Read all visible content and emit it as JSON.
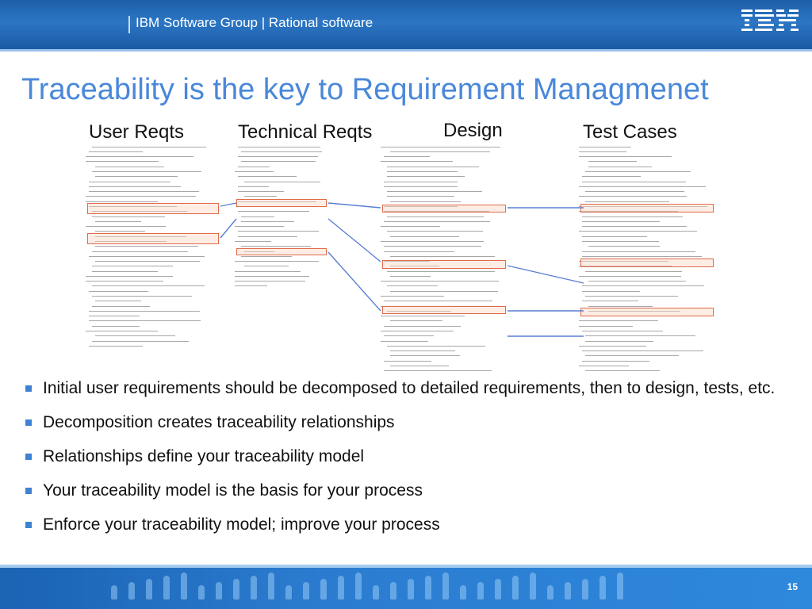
{
  "header": {
    "group_title": "IBM Software Group | Rational software",
    "logo_text": "IBM"
  },
  "slide": {
    "title": "Traceability is the key to Requirement Managmenet",
    "page_number": "15"
  },
  "columns": [
    {
      "label": "User Reqts"
    },
    {
      "label": "Technical Reqts"
    },
    {
      "label": "Design"
    },
    {
      "label": "Test Cases"
    }
  ],
  "bullets": [
    "Initial user requirements should be decomposed to detailed requirements, then to design, tests, etc.",
    "Decomposition creates traceability relationships",
    "Relationships define your traceability model",
    "Your traceability model is the basis for your process",
    "Enforce your traceability model; improve your process"
  ],
  "colors": {
    "accent_blue": "#4a88d9",
    "highlight_border": "#e06a4a",
    "trace_line": "#5b7fd6"
  }
}
